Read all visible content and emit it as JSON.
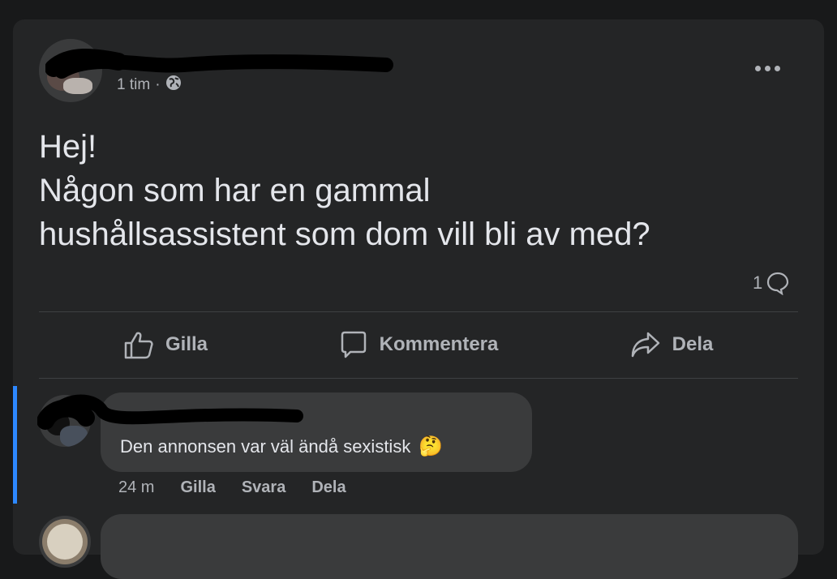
{
  "post": {
    "author": "",
    "time": "1 tim",
    "separator": "·",
    "privacy_icon": "globe-icon",
    "text_lines": [
      "Hej!",
      "Någon som har en gammal",
      "hushållsassistent som dom vill bli av med?"
    ],
    "comment_count": "1"
  },
  "actions": {
    "like": "Gilla",
    "comment": "Kommentera",
    "share": "Dela"
  },
  "comments": [
    {
      "text": "Den annonsen var väl ändå sexistisk",
      "emoji": "🤔",
      "time": "24 m",
      "like": "Gilla",
      "reply": "Svara",
      "share": "Dela"
    }
  ],
  "colors": {
    "background": "#18191a",
    "card": "#242526",
    "bubble": "#3a3b3c",
    "accent": "#2d88ff"
  }
}
